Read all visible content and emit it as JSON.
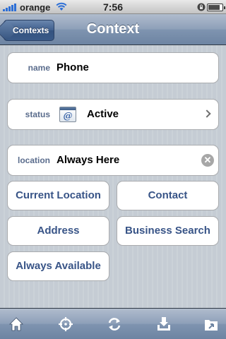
{
  "status_bar": {
    "carrier": "orange",
    "time": "7:56",
    "battery_level": 0.85
  },
  "nav": {
    "back_label": "Contexts",
    "title": "Context"
  },
  "fields": {
    "name": {
      "label": "name",
      "value": "Phone"
    },
    "status": {
      "label": "status",
      "value": "Active",
      "icon_glyph": "@"
    },
    "location": {
      "label": "location",
      "value": "Always Here"
    }
  },
  "location_buttons": [
    "Current Location",
    "Contact",
    "Address",
    "Business Search",
    "Always Available"
  ],
  "toolbar": {
    "icons": [
      "home-icon",
      "locate-icon",
      "refresh-icon",
      "inbox-download-icon",
      "move-to-folder-icon"
    ]
  },
  "colors": {
    "nav_bar": "#7f94b0",
    "label_text": "#5a6c8c",
    "button_text": "#385487",
    "background": "#c5ccd4"
  }
}
